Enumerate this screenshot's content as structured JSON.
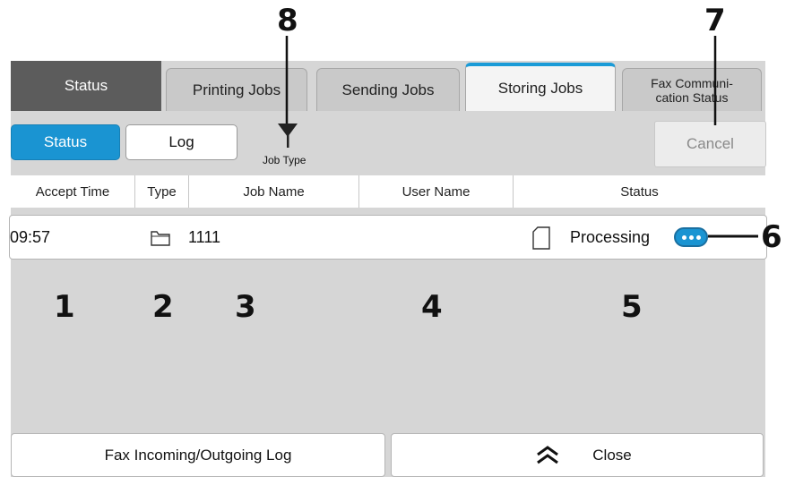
{
  "tabs": {
    "status": "Status",
    "printing_jobs": "Printing Jobs",
    "sending_jobs": "Sending Jobs",
    "storing_jobs": "Storing Jobs",
    "fax_communication_line1": "Fax Communi-",
    "fax_communication_line2": "cation Status"
  },
  "toolbar": {
    "status_label": "Status",
    "log_label": "Log",
    "job_type_label": "Job Type",
    "cancel_label": "Cancel"
  },
  "columns": [
    "Accept Time",
    "Type",
    "Job Name",
    "User Name",
    "Status"
  ],
  "job": {
    "accept_time": "09:57",
    "type_icon": "folder-icon",
    "job_name": "1111",
    "user_name": "",
    "status_icon": "document-icon",
    "status": "Processing"
  },
  "footer": {
    "fax_log_label": "Fax Incoming/Outgoing Log",
    "close_label": "Close"
  },
  "callouts": {
    "c1": "1",
    "c2": "2",
    "c3": "3",
    "c4": "4",
    "c5": "5",
    "c6": "6",
    "c7": "7",
    "c8": "8"
  },
  "colors": {
    "accent": "#1a94d2",
    "panel": "#d6d6d6",
    "dark_tab": "#5c5c5c"
  }
}
